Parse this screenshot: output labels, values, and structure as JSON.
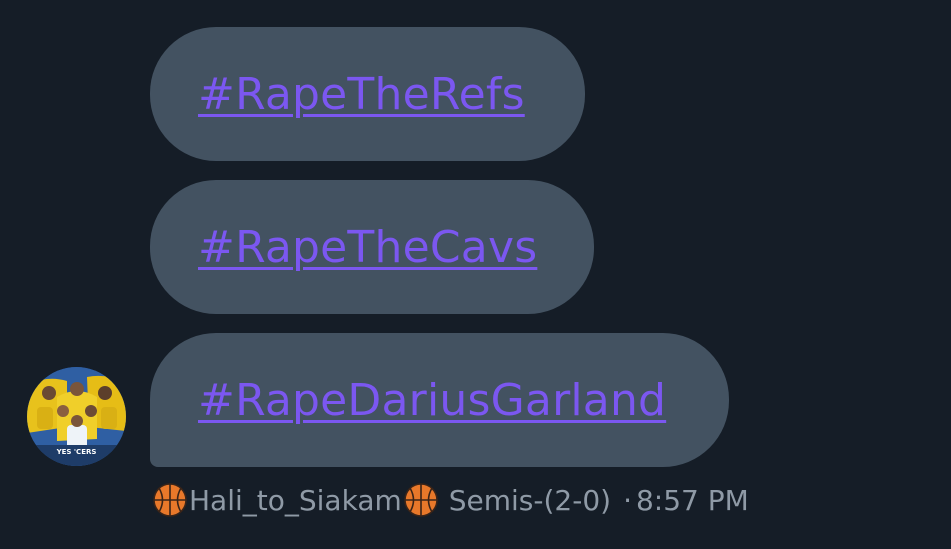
{
  "messages": [
    {
      "text": "#RapeTheRefs"
    },
    {
      "text": "#RapeTheCavs"
    },
    {
      "text": "#RapeDariusGarland"
    }
  ],
  "sender": {
    "name": "Hali_to_Siakam",
    "name_prefix_icon": "basketball-emoji",
    "name_suffix_icon": "basketball-emoji",
    "status": "Semis-(2-0)",
    "separator": "·",
    "timestamp": "8:57 PM",
    "avatar_caption": "YES 'CERS"
  },
  "colors": {
    "background": "#151d27",
    "bubble": "#435261",
    "hashtag": "#7b57f0",
    "meta_text": "#8f9aa6"
  }
}
